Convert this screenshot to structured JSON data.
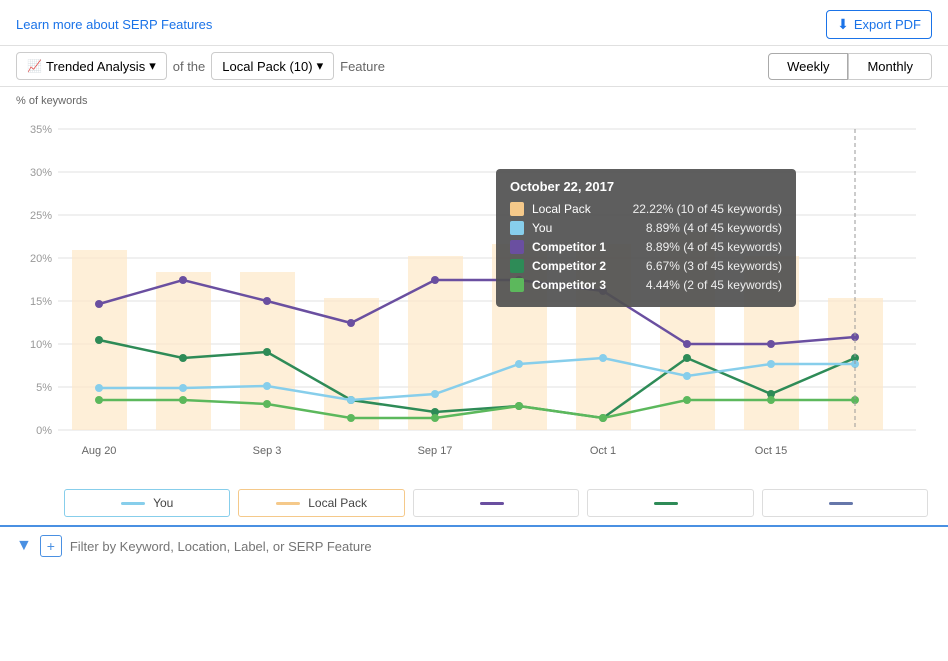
{
  "topBar": {
    "learnLink": "Learn more about SERP Features",
    "exportBtn": "Export PDF"
  },
  "controls": {
    "analysisBtn": "Trended Analysis",
    "ofThe": "of the",
    "featureSelect": "Local Pack (10)",
    "featureLabel": "Feature",
    "weeklyBtn": "Weekly",
    "monthlyBtn": "Monthly"
  },
  "chart": {
    "yAxisLabel": "% of keywords",
    "yTicks": [
      "35%",
      "30%",
      "25%",
      "20%",
      "15%",
      "10%",
      "5%",
      "0%"
    ],
    "xTicks": [
      "Aug 20",
      "Sep 3",
      "Sep 17",
      "Oct 1",
      "Oct 15"
    ]
  },
  "tooltip": {
    "date": "October 22, 2017",
    "rows": [
      {
        "name": "Local Pack",
        "value": "22.22% (10 of 45 keywords)",
        "color": "#f5c98a",
        "bold": false
      },
      {
        "name": "You",
        "value": "8.89% (4 of 45 keywords)",
        "color": "#87ceeb",
        "bold": false
      },
      {
        "name": "Competitor 1",
        "value": "8.89% (4 of 45 keywords)",
        "color": "#6a4fa0",
        "bold": true
      },
      {
        "name": "Competitor 2",
        "value": "6.67% (3 of 45 keywords)",
        "color": "#2e8b57",
        "bold": true
      },
      {
        "name": "Competitor 3",
        "value": "4.44% (2 of 45 keywords)",
        "color": "#4caf50",
        "bold": true
      }
    ]
  },
  "legend": [
    {
      "label": "You",
      "color": "#87ceeb",
      "active": true,
      "type": "you"
    },
    {
      "label": "Local Pack",
      "color": "#f5c98a",
      "active": true,
      "type": "local"
    },
    {
      "label": "",
      "color": "#6a4fa0",
      "active": false,
      "type": "comp1"
    },
    {
      "label": "",
      "color": "#2e8b57",
      "active": false,
      "type": "comp2"
    },
    {
      "label": "",
      "color": "#5b6fa0",
      "active": false,
      "type": "comp3"
    }
  ],
  "filter": {
    "placeholder": "Filter by Keyword, Location, Label, or SERP Feature"
  }
}
